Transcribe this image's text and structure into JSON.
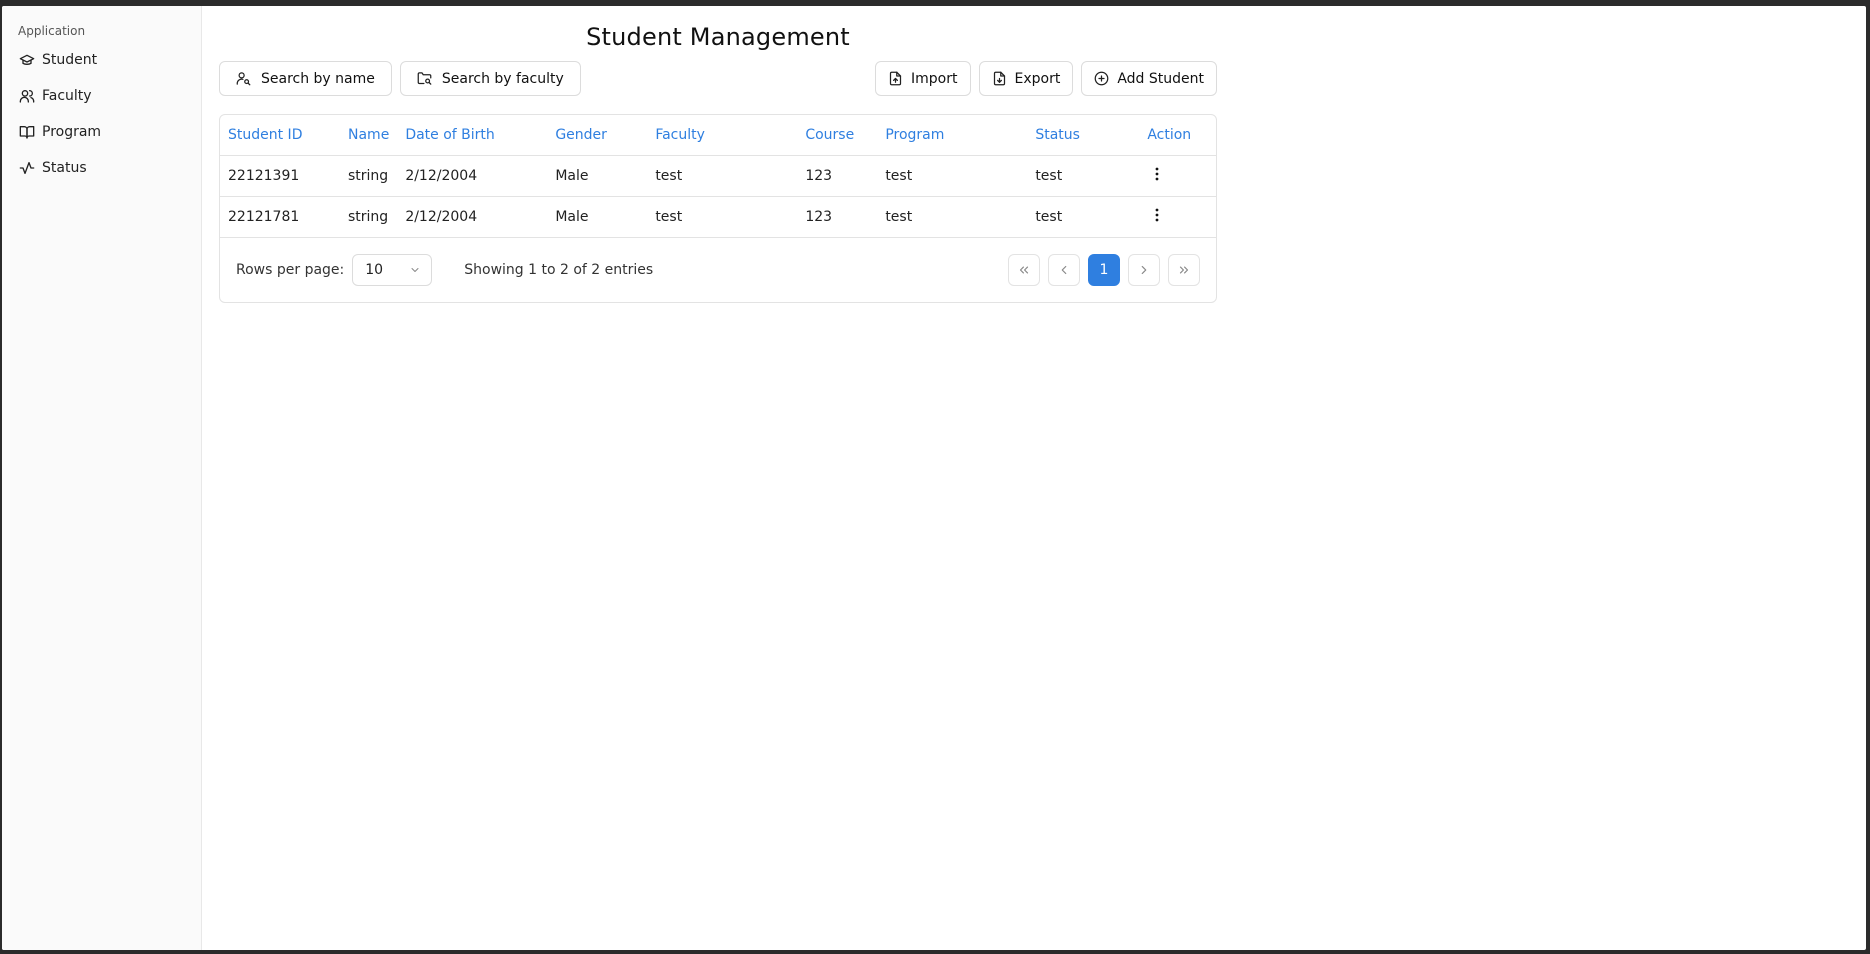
{
  "sidebar": {
    "group_label": "Application",
    "items": [
      {
        "label": "Student",
        "icon": "graduation-cap-icon"
      },
      {
        "label": "Faculty",
        "icon": "users-icon"
      },
      {
        "label": "Program",
        "icon": "book-open-icon"
      },
      {
        "label": "Status",
        "icon": "activity-icon"
      }
    ]
  },
  "header": {
    "title": "Student Management"
  },
  "toolbar": {
    "search_name": "Search by name",
    "search_faculty": "Search by faculty",
    "import": "Import",
    "export": "Export",
    "add_student": "Add Student"
  },
  "table": {
    "columns": [
      "Student ID",
      "Name",
      "Date of Birth",
      "Gender",
      "Faculty",
      "Course",
      "Program",
      "Status",
      "Action"
    ],
    "rows": [
      [
        "22121391",
        "string",
        "2/12/2004",
        "Male",
        "test",
        "123",
        "test",
        "test"
      ],
      [
        "22121781",
        "string",
        "2/12/2004",
        "Male",
        "test",
        "123",
        "test",
        "test"
      ]
    ]
  },
  "footer": {
    "rows_per_page_label": "Rows per page:",
    "rows_per_page_value": "10",
    "showing": "Showing 1 to 2 of 2 entries",
    "current_page": "1"
  },
  "colors": {
    "accent": "#2f7fe0",
    "sidebar_bg": "#fafafa",
    "border": "#e3e3e3"
  }
}
